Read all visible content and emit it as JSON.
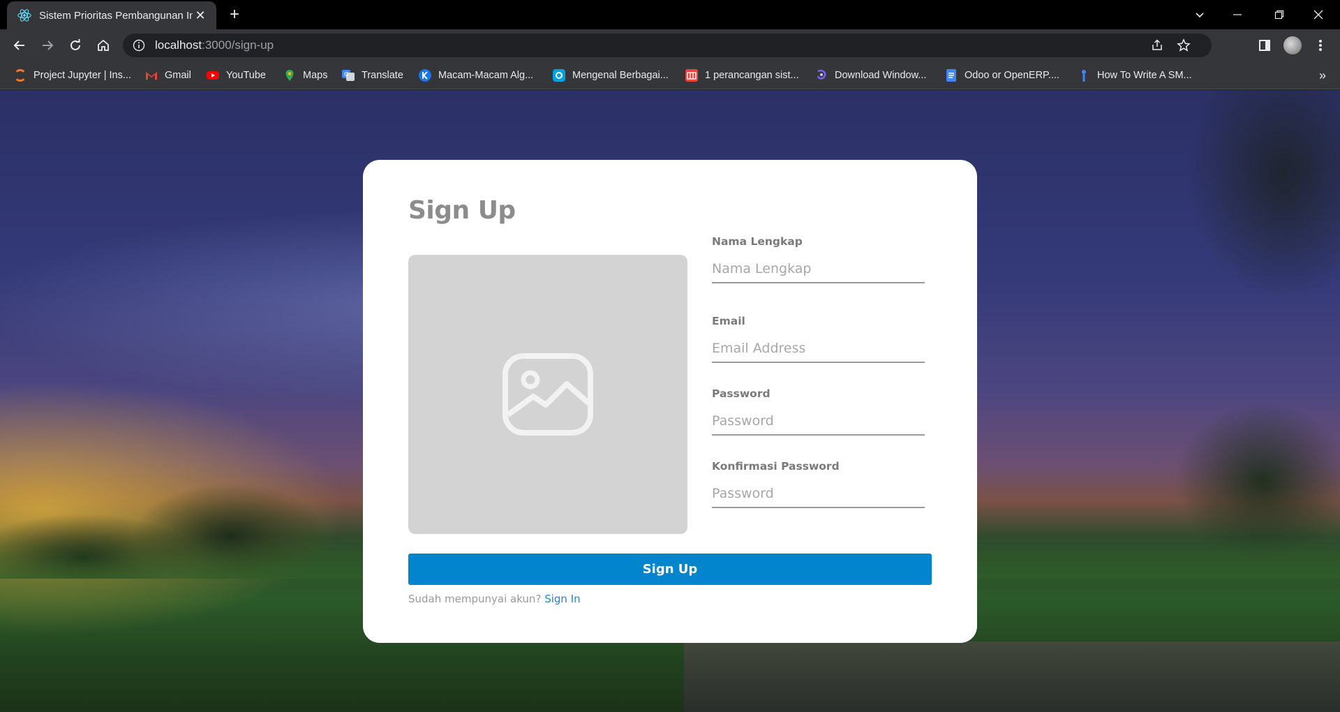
{
  "browser": {
    "tab": {
      "title": "Sistem Prioritas Pembangunan Infrastruktur",
      "favicon": "react-icon"
    },
    "url": {
      "host": "localhost",
      "path": ":3000/sign-up"
    },
    "bookmarks": [
      {
        "label": "Project Jupyter | Ins...",
        "icon": "jupyter-icon",
        "color": "#f37726"
      },
      {
        "label": "Gmail",
        "icon": "gmail-icon",
        "color": "#ea4335"
      },
      {
        "label": "YouTube",
        "icon": "youtube-icon",
        "color": "#ff0000"
      },
      {
        "label": "Maps",
        "icon": "maps-icon",
        "color": "#34a853"
      },
      {
        "label": "Translate",
        "icon": "translate-icon",
        "color": "#4285f4"
      },
      {
        "label": "Macam-Macam Alg...",
        "icon": "k-icon",
        "color": "#1a73e8"
      },
      {
        "label": "Mengenal Berbagai...",
        "icon": "site-icon",
        "color": "#00a3e0"
      },
      {
        "label": "1 perancangan sist...",
        "icon": "doc-icon",
        "color": "#e8453c"
      },
      {
        "label": "Download Window...",
        "icon": "download-icon",
        "color": "#7b61ff"
      },
      {
        "label": "Odoo or OpenERP....",
        "icon": "docs-icon",
        "color": "#4285f4"
      },
      {
        "label": "How To Write A SM...",
        "icon": "info-icon",
        "color": "#4285f4"
      }
    ]
  },
  "signup": {
    "title": "Sign Up",
    "photo_icon": "image-placeholder-icon",
    "fields": {
      "name": {
        "label": "Nama Lengkap",
        "placeholder": "Nama Lengkap"
      },
      "email": {
        "label": "Email",
        "placeholder": "Email Address"
      },
      "password": {
        "label": "Password",
        "placeholder": "Password"
      },
      "confirm": {
        "label": "Konfirmasi Password",
        "placeholder": "Password"
      }
    },
    "submit_label": "Sign Up",
    "footer_text": "Sudah mempunyai akun?",
    "footer_link": "Sign In",
    "accent_color": "#0385cd"
  }
}
